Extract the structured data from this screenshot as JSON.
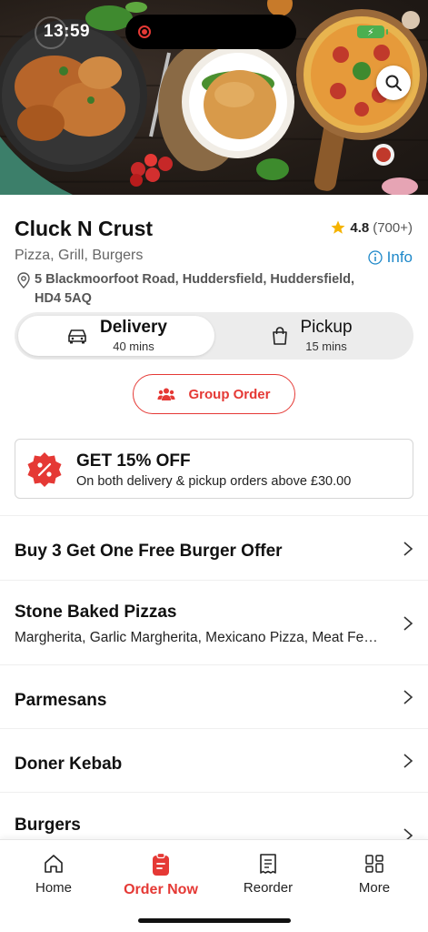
{
  "status_bar": {
    "time": "13:59"
  },
  "restaurant": {
    "name": "Cluck N Crust",
    "rating": "4.8",
    "rating_count": "(700+)",
    "cuisine": "Pizza, Grill, Burgers",
    "info_label": "Info",
    "address": "5 Blackmoorfoot Road, Huddersfield, Huddersfield, HD4 5AQ"
  },
  "order_mode": {
    "delivery": {
      "label": "Delivery",
      "time": "40 mins"
    },
    "pickup": {
      "label": "Pickup",
      "time": "15 mins"
    },
    "selected": "delivery"
  },
  "group_order": {
    "label": "Group Order"
  },
  "promo": {
    "title": "GET 15% OFF",
    "description": "On both delivery & pickup orders above £30.00"
  },
  "categories": [
    {
      "title": "Buy 3 Get One Free Burger Offer",
      "description": ""
    },
    {
      "title": "Stone Baked Pizzas",
      "description": "Margherita, Garlic Margherita, Mexicano Pizza, Meat Feast Pizza, Hawaiian Pizza"
    },
    {
      "title": "Parmesans",
      "description": ""
    },
    {
      "title": "Doner Kebab",
      "description": ""
    },
    {
      "title": "Burgers",
      "description": ""
    }
  ],
  "bottom_nav": [
    {
      "label": "Home",
      "icon": "home-icon"
    },
    {
      "label": "Order Now",
      "icon": "order-icon"
    },
    {
      "label": "Reorder",
      "icon": "receipt-icon"
    },
    {
      "label": "More",
      "icon": "grid-icon"
    }
  ],
  "colors": {
    "accent": "#e53935",
    "link": "#1e88c9",
    "star": "#f5b301"
  }
}
